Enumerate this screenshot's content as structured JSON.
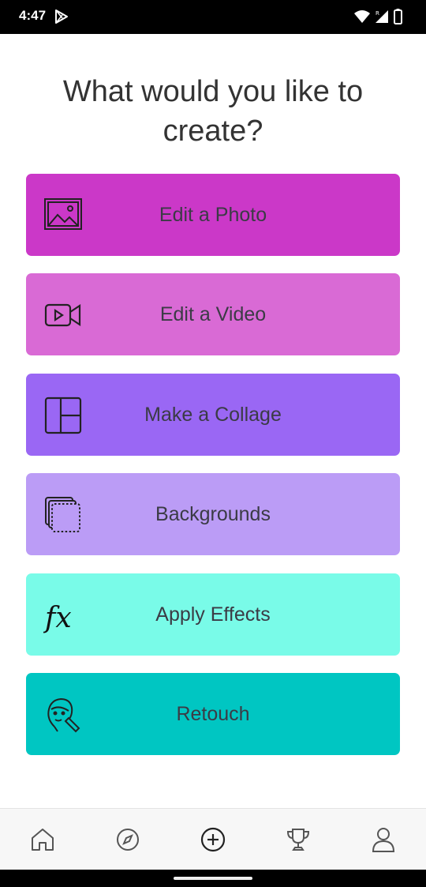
{
  "status_bar": {
    "time": "4:47",
    "icons": [
      "play-store-icon",
      "wifi-icon",
      "signal-icon",
      "battery-icon"
    ]
  },
  "header": {
    "title": "What would you like to create?"
  },
  "options": [
    {
      "label": "Edit a Photo",
      "icon": "image-icon",
      "color": "#cb38c8"
    },
    {
      "label": "Edit a Video",
      "icon": "video-camera-icon",
      "color": "#d96ad5"
    },
    {
      "label": "Make a Collage",
      "icon": "collage-grid-icon",
      "color": "#9a67f4"
    },
    {
      "label": "Backgrounds",
      "icon": "layers-icon",
      "color": "#bb9cf6"
    },
    {
      "label": "Apply Effects",
      "icon": "fx-icon",
      "color": "#79fbe8"
    },
    {
      "label": "Retouch",
      "icon": "face-retouch-icon",
      "color": "#00c6c2"
    }
  ],
  "bottom_nav": {
    "items": [
      "home-icon",
      "compass-icon",
      "add-circle-icon",
      "trophy-icon",
      "profile-icon"
    ]
  }
}
